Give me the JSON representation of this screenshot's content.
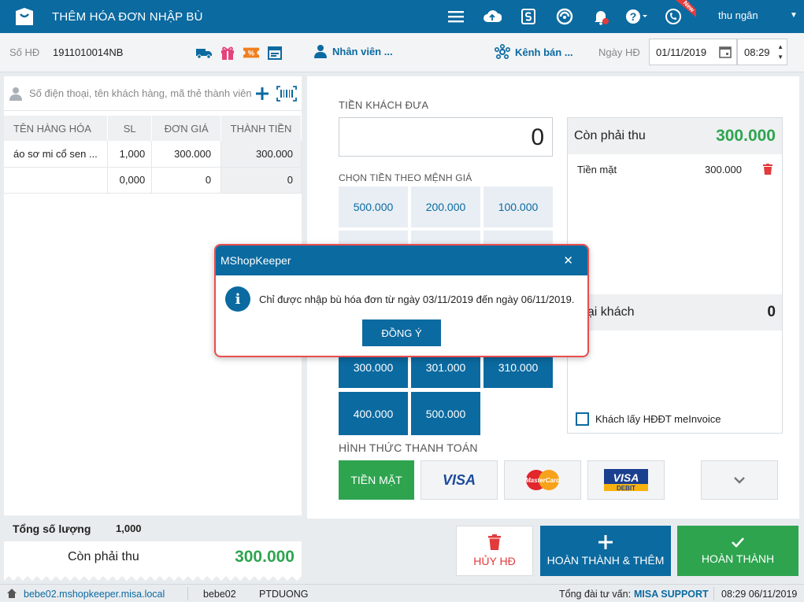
{
  "header": {
    "title": "THÊM HÓA ĐƠN NHẬP BÙ",
    "new_badge": "New",
    "user": "thu ngân"
  },
  "info": {
    "so_hd_label": "Số HĐ",
    "so_hd_value": "1911010014NB",
    "nhan_vien": "Nhân viên ...",
    "kenh_ban": "Kênh bán ...",
    "ngay_hd_label": "Ngày HĐ",
    "date": "01/11/2019",
    "time": "08:29"
  },
  "search": {
    "placeholder": "Số điện thoại, tên khách hàng, mã thẻ thành viên"
  },
  "table": {
    "headers": [
      "TÊN HÀNG HÓA",
      "SL",
      "ĐƠN GIÁ",
      "THÀNH TIỀN"
    ],
    "rows": [
      [
        "áo sơ mi cổ sen ...",
        "1,000",
        "300.000",
        "300.000"
      ],
      [
        "",
        "0,000",
        "0",
        "0"
      ]
    ]
  },
  "totals": {
    "qty_label": "Tổng số lượng",
    "qty_value": "1,000",
    "remain_label": "Còn phải thu",
    "remain_value": "300.000"
  },
  "payment": {
    "cash_label": "TIỀN KHÁCH ĐƯA",
    "cash_value": "0",
    "denom_label": "CHỌN TIỀN THEO MỆNH GIÁ",
    "denoms_row1": [
      "500.000",
      "200.000",
      "100.000"
    ],
    "denoms_row3": [
      "300.000",
      "301.000",
      "310.000"
    ],
    "denoms_row4": [
      "400.000",
      "500.000"
    ],
    "method_label": "HÌNH THỨC THANH TOÁN",
    "method_cash": "TIỀN MẶT",
    "visa": "VISA",
    "mastercard": "MasterCard",
    "visa_debit_top": "VISA",
    "visa_debit_bottom": "DEBIT"
  },
  "summary": {
    "head_label": "Còn phải thu",
    "head_value": "300.000",
    "row_label": "Tiền mặt",
    "row_value": "300.000",
    "return_label": "a lại khách",
    "return_value": "0",
    "einvoice": "Khách lấy HĐĐT meInvoice"
  },
  "actions": {
    "cancel": "HỦY HĐ",
    "save_more": "HOÀN THÀNH & THÊM",
    "done": "HOÀN THÀNH"
  },
  "status": {
    "url": "bebe02.mshopkeeper.misa.local",
    "user": "bebe02",
    "employee": "PTDUONG",
    "support_label": "Tổng đài tư vấn:",
    "support": "MISA SUPPORT",
    "datetime": "08:29 06/11/2019"
  },
  "modal": {
    "title": "MShopKeeper",
    "message": "Chỉ được nhập bù hóa đơn từ ngày 03/11/2019 đến ngày 06/11/2019.",
    "ok": "ĐỒNG Ý"
  },
  "colors": {
    "primary": "#0b6aa0",
    "green": "#2ea44f",
    "red": "#e23b3b"
  }
}
